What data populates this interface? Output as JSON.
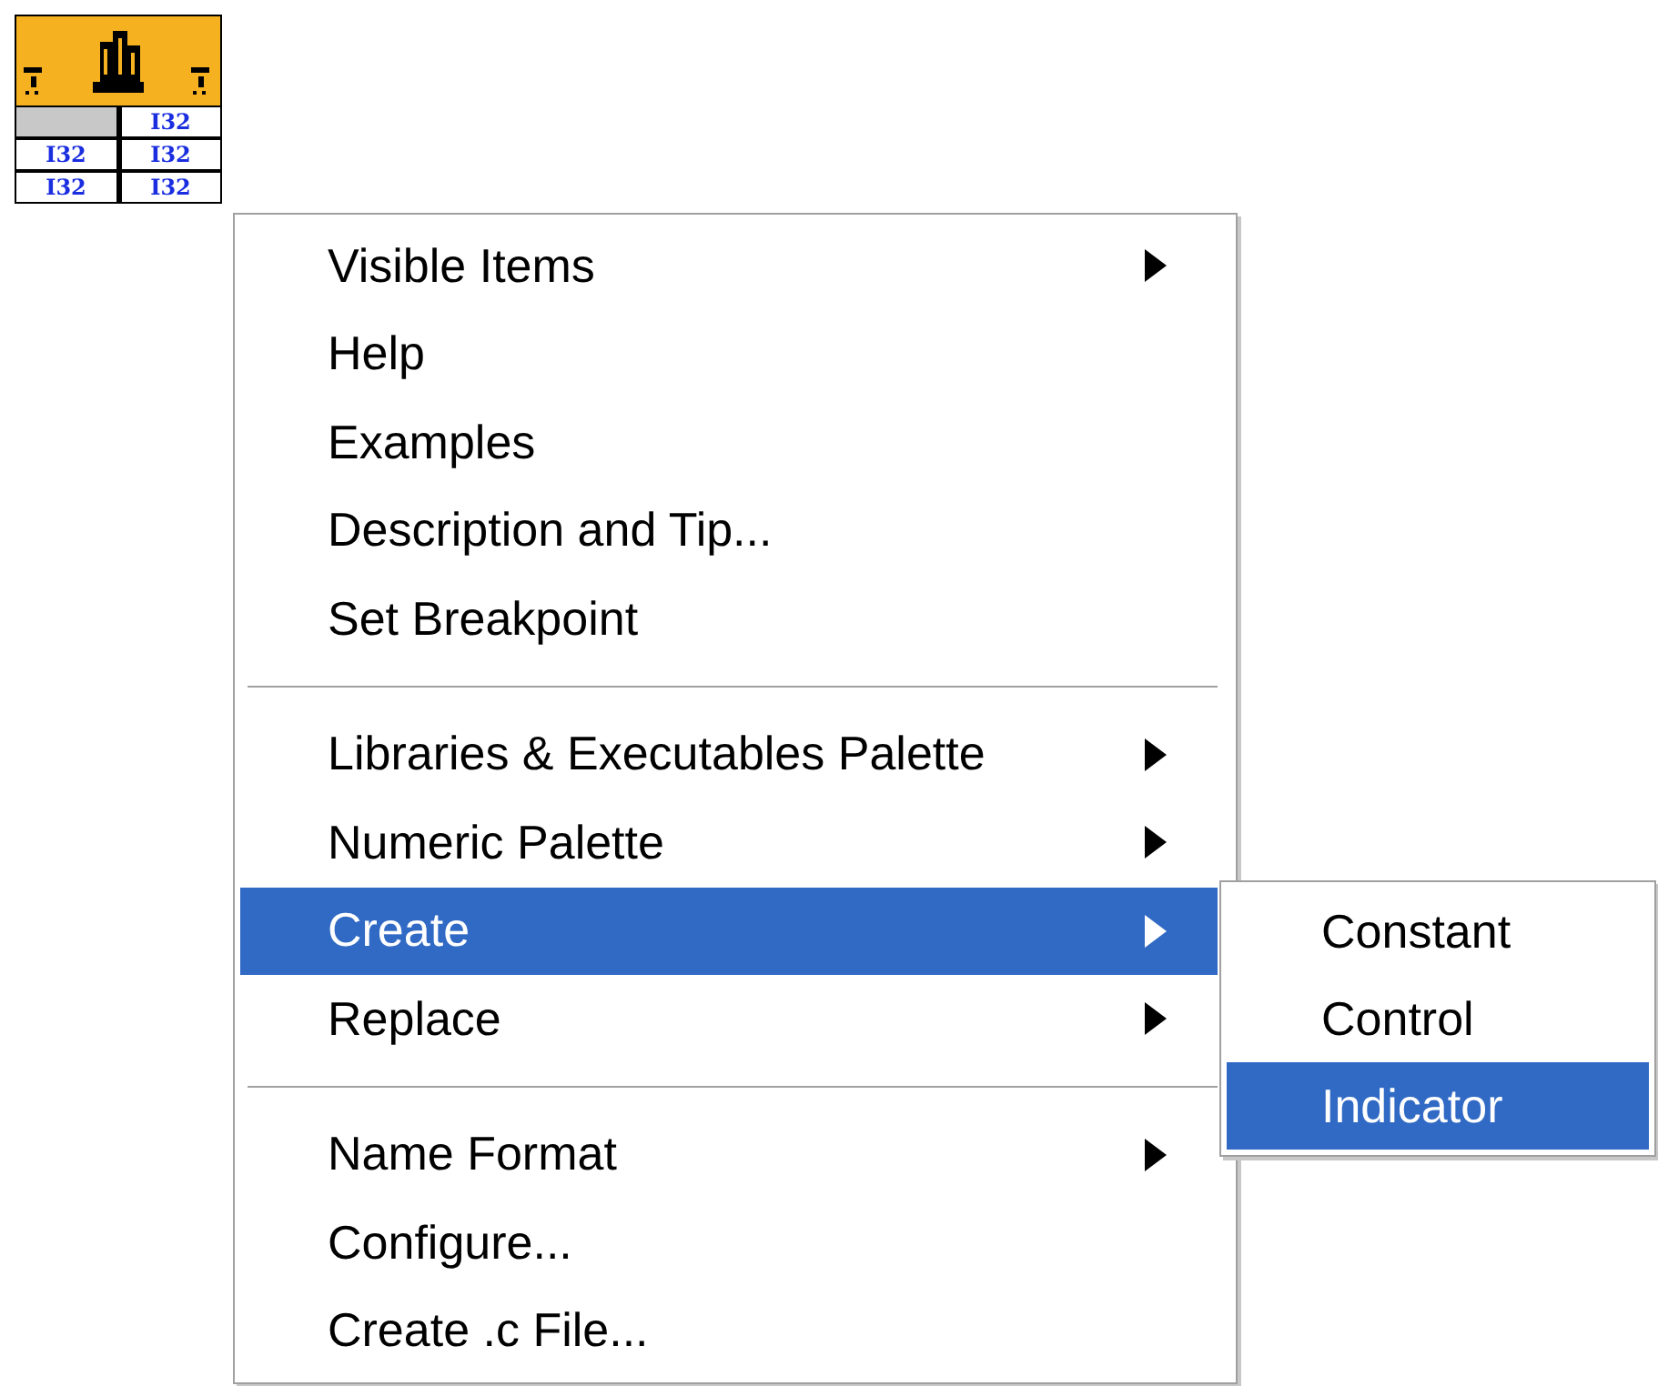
{
  "node": {
    "cells": [
      {
        "kind": "blank"
      },
      {
        "kind": "type",
        "label": "I32"
      },
      {
        "kind": "type",
        "label": "I32"
      },
      {
        "kind": "type",
        "label": "I32"
      },
      {
        "kind": "type",
        "label": "I32"
      },
      {
        "kind": "type",
        "label": "I32"
      }
    ]
  },
  "menu": {
    "groups": [
      [
        {
          "label": "Visible Items",
          "submenu": true,
          "selected": false
        },
        {
          "label": "Help",
          "submenu": false,
          "selected": false
        },
        {
          "label": "Examples",
          "submenu": false,
          "selected": false
        },
        {
          "label": "Description and Tip...",
          "submenu": false,
          "selected": false
        },
        {
          "label": "Set Breakpoint",
          "submenu": false,
          "selected": false
        }
      ],
      [
        {
          "label": "Libraries & Executables Palette",
          "submenu": true,
          "selected": false
        },
        {
          "label": "Numeric Palette",
          "submenu": true,
          "selected": false
        },
        {
          "label": "Create",
          "submenu": true,
          "selected": true
        },
        {
          "label": "Replace",
          "submenu": true,
          "selected": false
        }
      ],
      [
        {
          "label": "Name Format",
          "submenu": true,
          "selected": false
        },
        {
          "label": "Configure...",
          "submenu": false,
          "selected": false
        },
        {
          "label": "Create .c File...",
          "submenu": false,
          "selected": false
        }
      ]
    ]
  },
  "submenu": {
    "items": [
      {
        "label": "Constant",
        "selected": false
      },
      {
        "label": "Control",
        "selected": false
      },
      {
        "label": "Indicator",
        "selected": true
      }
    ]
  }
}
